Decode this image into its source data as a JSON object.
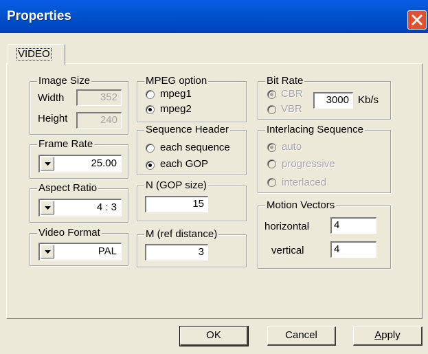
{
  "window": {
    "title": "Properties"
  },
  "tabs": [
    {
      "label": "VIDEO"
    }
  ],
  "image_size": {
    "legend": "Image Size",
    "width_label": "Width",
    "width_value": "352",
    "height_label": "Height",
    "height_value": "240"
  },
  "frame_rate": {
    "legend": "Frame Rate",
    "value": "25.00"
  },
  "aspect_ratio": {
    "legend": "Aspect Ratio",
    "value": "4 : 3"
  },
  "video_format": {
    "legend": "Video Format",
    "value": "PAL"
  },
  "mpeg_option": {
    "legend": "MPEG option",
    "options": [
      {
        "label": "mpeg1",
        "selected": false
      },
      {
        "label": "mpeg2",
        "selected": true
      }
    ]
  },
  "sequence_header": {
    "legend": "Sequence Header",
    "options": [
      {
        "label": "each sequence",
        "selected": false
      },
      {
        "label": "each GOP",
        "selected": true
      }
    ]
  },
  "gop_size": {
    "legend": "N (GOP size)",
    "value": "15"
  },
  "ref_distance": {
    "legend": "M (ref distance)",
    "value": "3"
  },
  "bit_rate": {
    "legend": "Bit Rate",
    "options": [
      {
        "label": "CBR",
        "selected": true
      },
      {
        "label": "VBR",
        "selected": false
      }
    ],
    "value": "3000",
    "unit": "Kb/s"
  },
  "interlacing": {
    "legend": "Interlacing Sequence",
    "options": [
      {
        "label": "auto",
        "selected": true
      },
      {
        "label": "progressive",
        "selected": false
      },
      {
        "label": "interlaced",
        "selected": false
      }
    ]
  },
  "motion_vectors": {
    "legend": "Motion Vectors",
    "horizontal_label": "horizontal",
    "horizontal_value": "4",
    "vertical_label": "vertical",
    "vertical_value": "4"
  },
  "buttons": {
    "ok": "OK",
    "cancel": "Cancel",
    "apply": "Apply"
  },
  "colors": {
    "titlebar": "#0052cc",
    "close": "#e3502d",
    "face": "#ece9d8",
    "disabled_text": "#a7a6aa"
  },
  "icons": {
    "close": "close-icon",
    "dropdown": "chevron-down-icon"
  }
}
